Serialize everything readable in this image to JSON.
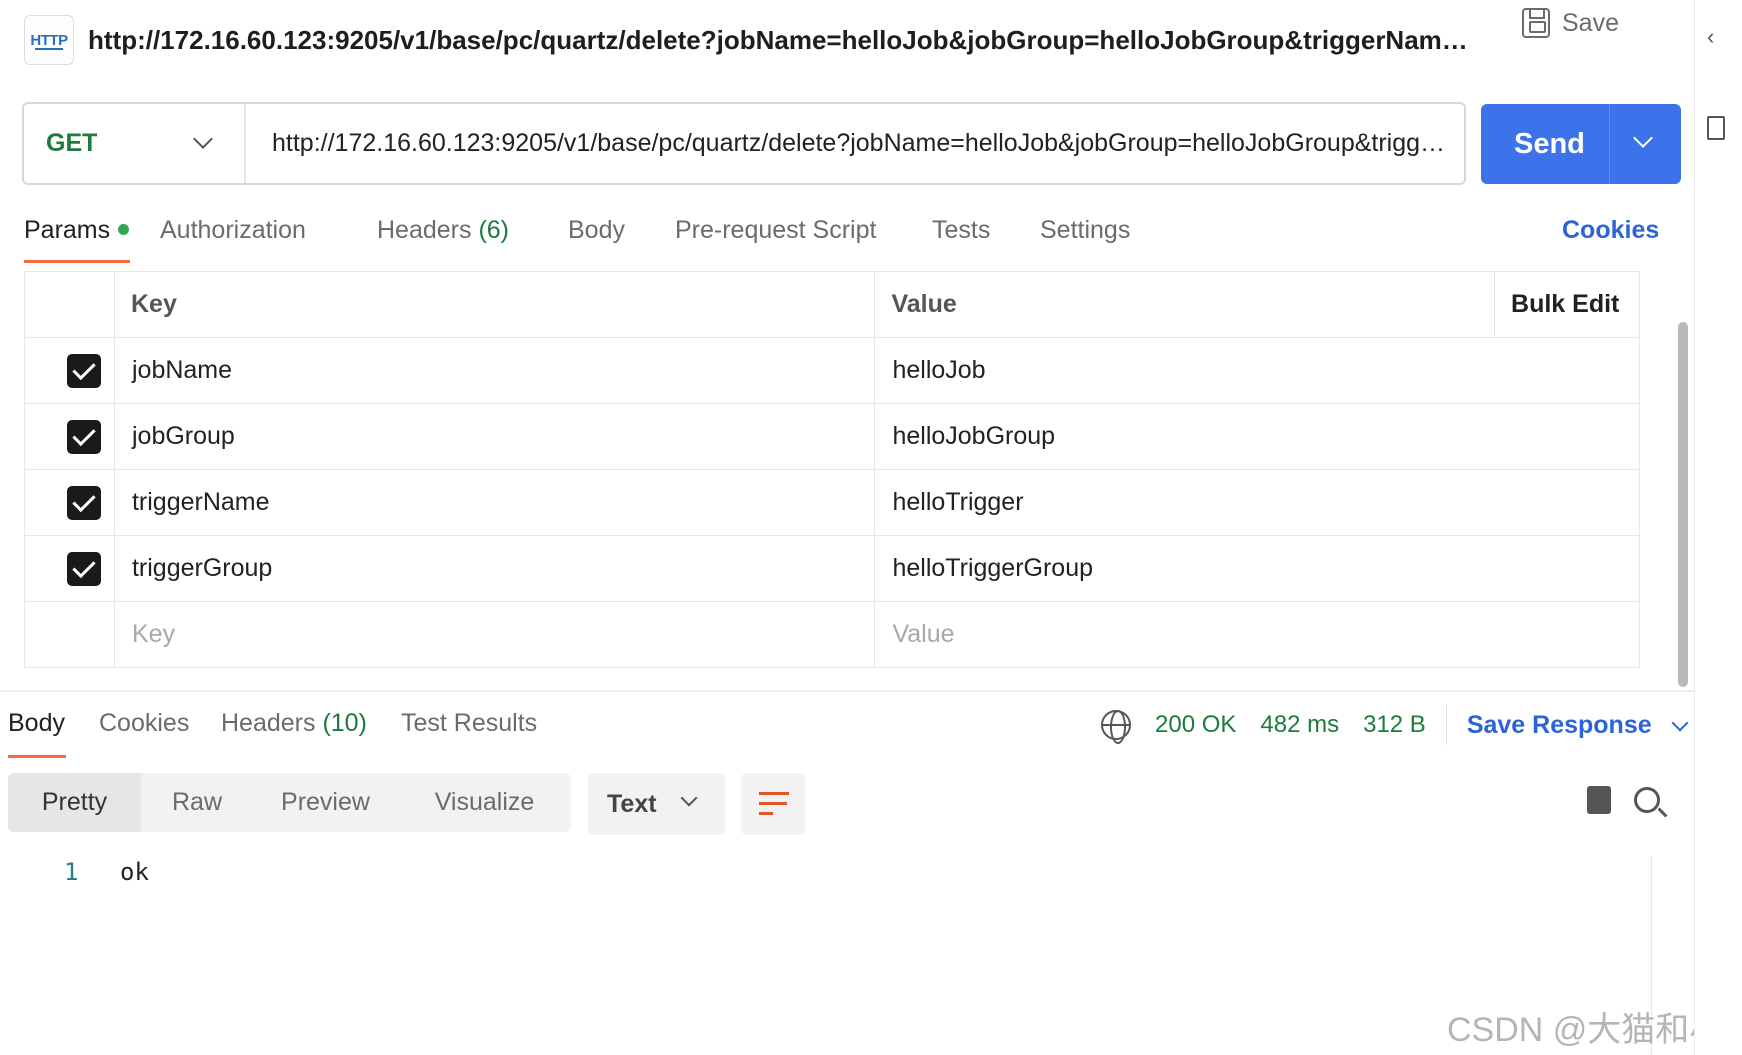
{
  "request": {
    "title": "http://172.16.60.123:9205/v1/base/pc/quartz/delete?jobName=helloJob&jobGroup=helloJobGroup&triggerName=hel...",
    "icon_label": "HTTP",
    "save_label": "Save",
    "method": "GET",
    "url": "http://172.16.60.123:9205/v1/base/pc/quartz/delete?jobName=helloJob&jobGroup=helloJobGroup&triggerName=helloTrigger&triggerGroup=helloTriggerGroup",
    "send_label": "Send"
  },
  "request_tabs": [
    {
      "label": "Params"
    },
    {
      "label": "Authorization"
    },
    {
      "label": "Headers",
      "count": "(6)"
    },
    {
      "label": "Body"
    },
    {
      "label": "Pre-request Script"
    },
    {
      "label": "Tests"
    },
    {
      "label": "Settings"
    }
  ],
  "cookies_label": "Cookies",
  "params": {
    "key_header": "Key",
    "value_header": "Value",
    "bulk_edit_label": "Bulk Edit",
    "rows": [
      {
        "key": "jobName",
        "value": "helloJob",
        "checked": true
      },
      {
        "key": "jobGroup",
        "value": "helloJobGroup",
        "checked": true
      },
      {
        "key": "triggerName",
        "value": "helloTrigger",
        "checked": true
      },
      {
        "key": "triggerGroup",
        "value": "helloTriggerGroup",
        "checked": true
      }
    ],
    "key_placeholder": "Key",
    "value_placeholder": "Value"
  },
  "response_tabs": [
    {
      "label": "Body"
    },
    {
      "label": "Cookies"
    },
    {
      "label": "Headers",
      "count": "(10)"
    },
    {
      "label": "Test Results"
    }
  ],
  "response": {
    "status": "200 OK",
    "time": "482 ms",
    "size": "312 B",
    "save_response_label": "Save Response",
    "view_modes": [
      "Pretty",
      "Raw",
      "Preview",
      "Visualize"
    ],
    "format": "Text",
    "lines": [
      {
        "number": "1",
        "text": "ok"
      }
    ]
  },
  "watermark": "CSDN @大猫和小黄",
  "colors": {
    "accent": "#3d73ea",
    "active_tab": "#f26b3a",
    "status_green": "#1e7a3d",
    "link_blue": "#2c63d6"
  }
}
